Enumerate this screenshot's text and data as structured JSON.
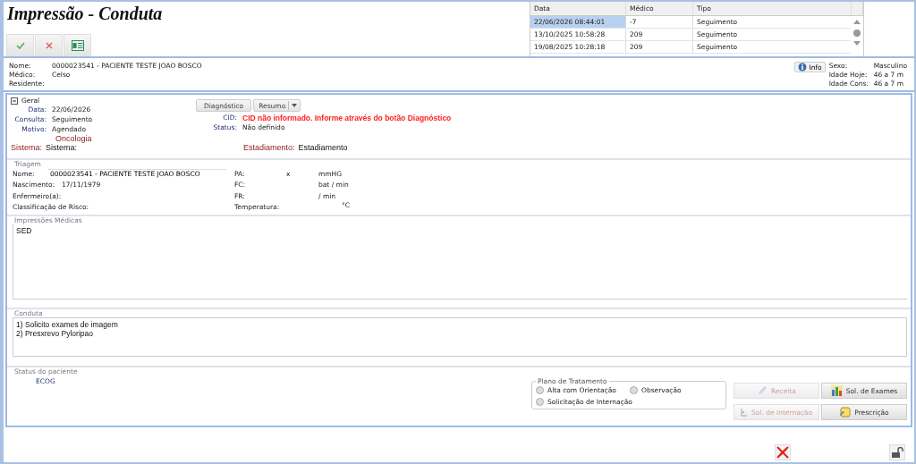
{
  "title": "Impressão - Conduta",
  "history": {
    "columns": [
      "Data",
      "Médico",
      "Tipo"
    ],
    "rows": [
      {
        "cells": [
          "22/06/2026 08:44:01",
          "-7",
          "Seguimento"
        ],
        "selected": true
      },
      {
        "cells": [
          "13/10/2025 10:58:28",
          "209",
          "Seguimento"
        ],
        "selected": false
      },
      {
        "cells": [
          "19/08/2025 10:28:18",
          "209",
          "Seguimento"
        ],
        "selected": false
      }
    ]
  },
  "patient": {
    "fields": [
      {
        "label": "Nome:",
        "value": "0000023541 - PACIENTE TESTE JOAO BOSCO"
      },
      {
        "label": "Médico:",
        "value": "Celso"
      },
      {
        "label": "Residente:"
      }
    ],
    "info_button": "Info",
    "demographics": [
      {
        "label": "Sexo:",
        "value": "Masculino"
      },
      {
        "label": "Idade Hoje:",
        "value": "46 a 7 m"
      },
      {
        "label": "Idade Cons:",
        "value": "46 a 7 m"
      }
    ]
  },
  "geral": {
    "title": "Geral",
    "expanded": true,
    "fields": [
      {
        "label": "Data:",
        "value": "22/06/2026"
      },
      {
        "label": "Consulta:",
        "value": "Seguimento"
      },
      {
        "label": "Motivo:",
        "value": "Agendado"
      }
    ],
    "diagnostico_button": "Diagnóstico",
    "resumo_button": "Resumo",
    "cid": {
      "label": "CID:",
      "value": "CID não informado. Informe através do botão Diagnóstico"
    },
    "status": {
      "label": "Status:",
      "value": "Não definido"
    },
    "specialty": "Oncologia",
    "sistema": {
      "label": "Sistema:",
      "value": "Sistema:"
    },
    "estadiamento": {
      "label": "Estadiamento:",
      "value": "Estadiamento"
    }
  },
  "triagem": {
    "title": "Triagem",
    "left": [
      {
        "label": "Nome:",
        "value": "0000023541 - PACIENTE TESTE JOAO BOSCO",
        "kind": "field"
      },
      {
        "label": "Nascimento:",
        "value": "17/11/1979",
        "kind": "text"
      },
      {
        "label": "Enfermeiro(a):",
        "kind": "text"
      },
      {
        "label": "Classificação de Risco:",
        "kind": "text"
      }
    ],
    "right": [
      {
        "label": "PA:",
        "value": "x",
        "unit": "mmHG"
      },
      {
        "label": "FC:",
        "unit": "bat / min"
      },
      {
        "label": "FR:",
        "unit": "/ min"
      },
      {
        "label": "Temperatura:",
        "unit": "°C"
      }
    ]
  },
  "impressoes": {
    "title": "Impressões Médicas",
    "value": "SED"
  },
  "conduta": {
    "title": "Conduta",
    "value": "1) Solicito exames de imagem\n2) Presxrevo Pyloripao"
  },
  "status_paciente": {
    "title": "Status do paciente",
    "ecog": "ECOG",
    "plano": {
      "title": "Plano de Tratamento",
      "options": [
        {
          "label": "Alta com Orientação",
          "selected": false
        },
        {
          "label": "Observação",
          "selected": false
        },
        {
          "label": "Solicitação de Internação",
          "selected": false
        }
      ]
    },
    "actions": [
      {
        "kind": "recipe",
        "label": "Receita",
        "disabled": true
      },
      {
        "kind": "exams",
        "label": "Sol. de Exames",
        "disabled": false
      },
      {
        "kind": "admission",
        "label": "Sol. de Internação",
        "disabled": true
      },
      {
        "kind": "prescription",
        "label": "Prescrição",
        "disabled": false
      }
    ]
  }
}
